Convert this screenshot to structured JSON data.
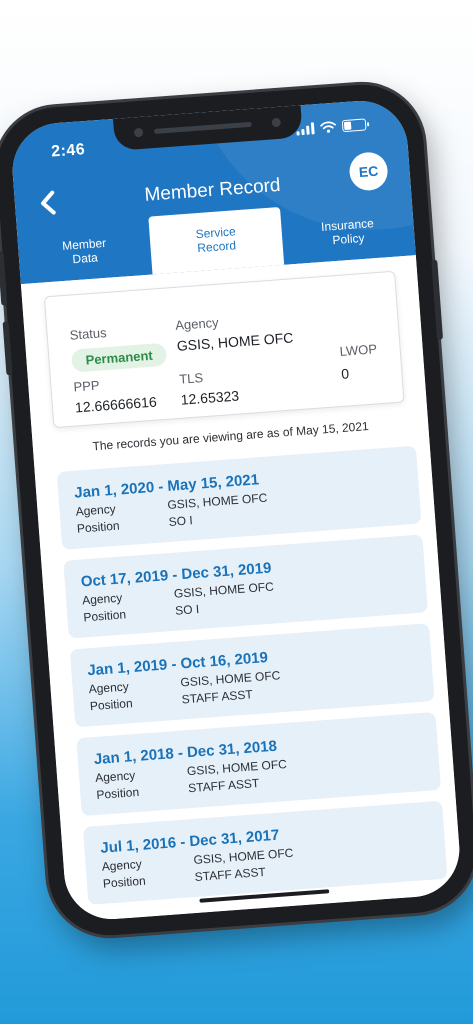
{
  "status_bar": {
    "time": "2:46"
  },
  "header": {
    "title": "Member Record",
    "avatar_initials": "EC",
    "tabs": [
      {
        "line1": "Member",
        "line2": "Data"
      },
      {
        "line1": "Service",
        "line2": "Record"
      },
      {
        "line1": "Insurance",
        "line2": "Policy"
      }
    ]
  },
  "summary": {
    "status_label": "Status",
    "status_value": "Permanent",
    "agency_label": "Agency",
    "agency_value": "GSIS, HOME OFC",
    "ppp_label": "PPP",
    "ppp_value": "12.66666616",
    "tls_label": "TLS",
    "tls_value": "12.65323",
    "lwop_label": "LWOP",
    "lwop_value": "0"
  },
  "as_of_text": "The records you are viewing are as of May 15, 2021",
  "records": [
    {
      "period": "Jan 1, 2020 - May 15, 2021",
      "agency_label": "Agency",
      "agency": "GSIS, HOME OFC",
      "position_label": "Position",
      "position": "SO I"
    },
    {
      "period": "Oct 17, 2019 - Dec 31, 2019",
      "agency_label": "Agency",
      "agency": "GSIS, HOME OFC",
      "position_label": "Position",
      "position": "SO I"
    },
    {
      "period": "Jan 1, 2019 - Oct 16, 2019",
      "agency_label": "Agency",
      "agency": "GSIS, HOME OFC",
      "position_label": "Position",
      "position": "STAFF ASST"
    },
    {
      "period": "Jan 1, 2018 - Dec 31, 2018",
      "agency_label": "Agency",
      "agency": "GSIS, HOME OFC",
      "position_label": "Position",
      "position": "STAFF ASST"
    },
    {
      "period": "Jul 1, 2016 - Dec 31, 2017",
      "agency_label": "Agency",
      "agency": "GSIS, HOME OFC",
      "position_label": "Position",
      "position": "STAFF ASST"
    }
  ],
  "colors": {
    "primary": "#1f76c2",
    "record_bg": "#e6f0f8",
    "permanent_badge_bg": "#e2f3e6",
    "permanent_badge_text": "#2e8a47"
  }
}
